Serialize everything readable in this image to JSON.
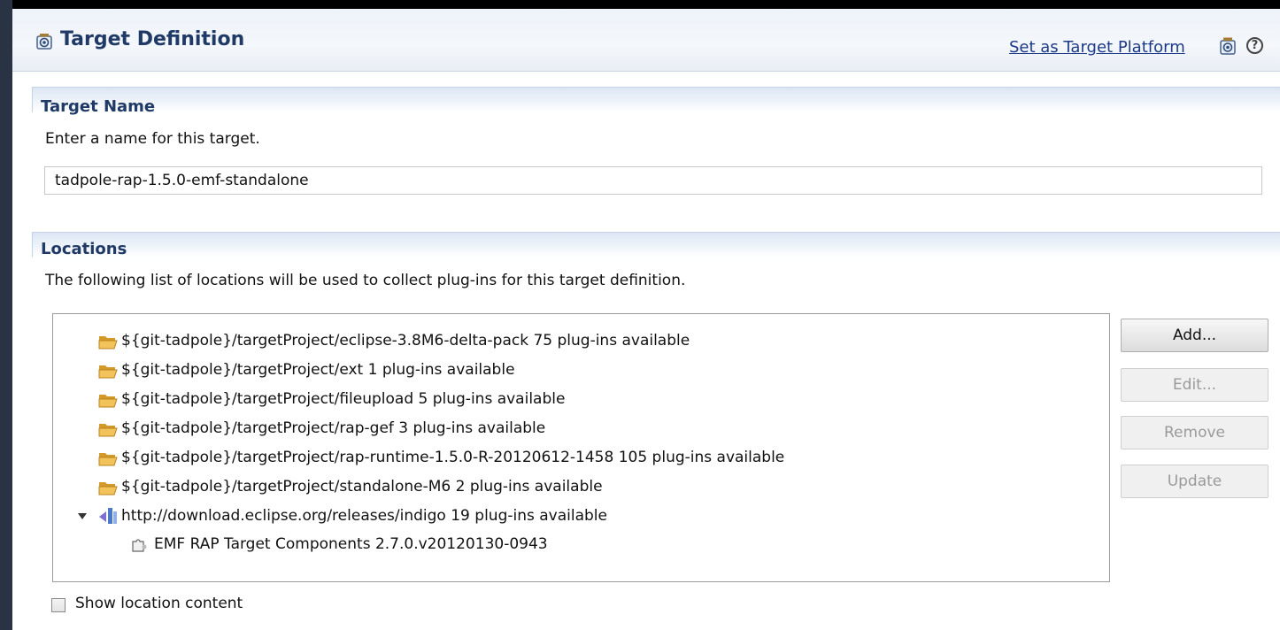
{
  "header": {
    "title": "Target Definition",
    "set_target_link": "Set as Target Platform",
    "help_symbol": "?"
  },
  "target_name": {
    "section_title": "Target Name",
    "description": "Enter a name for this target.",
    "value": "tadpole-rap-1.5.0-emf-standalone"
  },
  "locations": {
    "section_title": "Locations",
    "description": "The following list of locations will be used to collect plug-ins for this target definition.",
    "items": [
      {
        "label": "${git-tadpole}/targetProject/eclipse-3.8M6-delta-pack 75 plug-ins available",
        "icon": "folder-icon"
      },
      {
        "label": "${git-tadpole}/targetProject/ext 1 plug-ins available",
        "icon": "folder-icon"
      },
      {
        "label": "${git-tadpole}/targetProject/fileupload 5 plug-ins available",
        "icon": "folder-icon"
      },
      {
        "label": "${git-tadpole}/targetProject/rap-gef 3 plug-ins available",
        "icon": "folder-icon"
      },
      {
        "label": "${git-tadpole}/targetProject/rap-runtime-1.5.0-R-20120612-1458 105 plug-ins available",
        "icon": "folder-icon"
      },
      {
        "label": "${git-tadpole}/targetProject/standalone-M6 2 plug-ins available",
        "icon": "folder-icon"
      },
      {
        "label": "http://download.eclipse.org/releases/indigo 19 plug-ins available",
        "icon": "update-site-icon",
        "expanded": true
      },
      {
        "label": "EMF RAP Target Components 2.7.0.v20120130-0943",
        "icon": "feature-icon",
        "child": true
      }
    ],
    "buttons": {
      "add": "Add...",
      "edit": "Edit...",
      "remove": "Remove",
      "update": "Update"
    },
    "show_content_label": "Show location content",
    "show_content_checked": false
  },
  "colors": {
    "header_title": "#1f3a66",
    "link": "#1c3a8a",
    "folder": "#e8b03c"
  }
}
